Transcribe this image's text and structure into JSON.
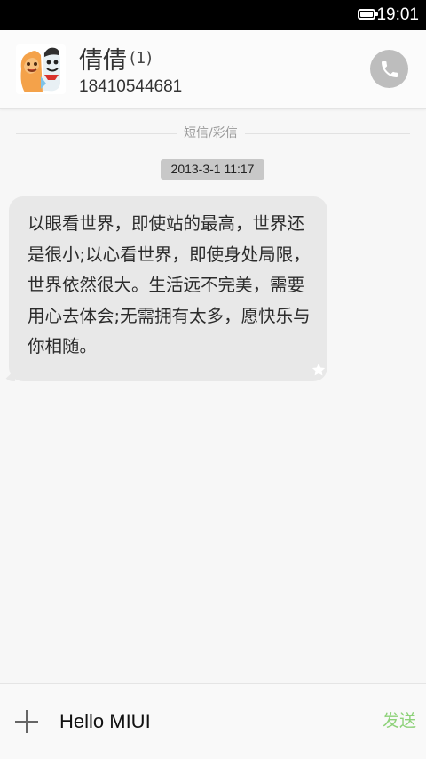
{
  "status_bar": {
    "time": "19:01",
    "battery_icon": "battery-full-icon"
  },
  "header": {
    "contact_name": "倩倩",
    "unread_count": "(1)",
    "phone_number": "18410544681",
    "avatar_icon": "contact-avatar-icon",
    "call_icon": "phone-icon"
  },
  "thread": {
    "message_type_label": "短信/彩信",
    "timestamp": "2013-3-1 11:17",
    "messages": [
      {
        "text": "以眼看世界，即使站的最高，世界还是很小;以心看世界，即使身处局限，世界依然很大。生活远不完美，需要用心去体会;无需拥有太多，愿快乐与你相随。",
        "direction": "incoming",
        "starred": true
      }
    ]
  },
  "composer": {
    "attach_icon": "plus-icon",
    "input_value": "Hello MIUI",
    "send_label": "发送"
  },
  "colors": {
    "status_bar_bg": "#000000",
    "bubble_bg": "#e8e8e8",
    "timestamp_bg": "#c8c8c8",
    "send_green": "#8ed27a",
    "call_button_gray": "#bdbdbd",
    "input_underline": "#7fb8d8"
  }
}
